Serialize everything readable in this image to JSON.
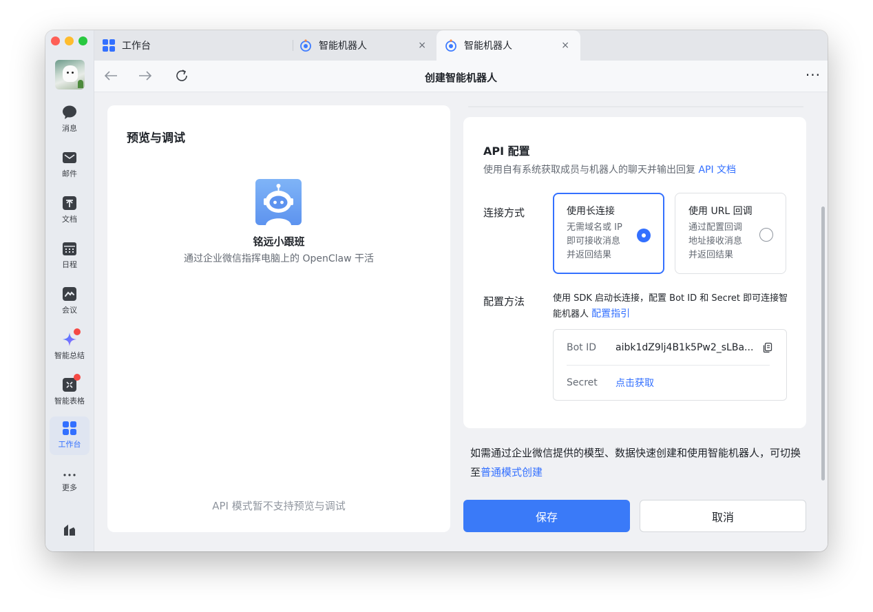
{
  "window": {
    "traffic_colors": [
      "#fe5f57",
      "#febc2e",
      "#28c840"
    ]
  },
  "rail": {
    "items": [
      {
        "label": "消息",
        "icon": "chat-bubble-icon"
      },
      {
        "label": "邮件",
        "icon": "mail-icon"
      },
      {
        "label": "文档",
        "icon": "document-icon"
      },
      {
        "label": "日程",
        "icon": "calendar-icon"
      },
      {
        "label": "会议",
        "icon": "meeting-icon"
      },
      {
        "label": "智能总结",
        "icon": "sparkle-icon",
        "badge": true
      },
      {
        "label": "智能表格",
        "icon": "smart-sheet-icon",
        "badge": true
      },
      {
        "label": "工作台",
        "icon": "workbench-icon",
        "active": true
      },
      {
        "label": "更多",
        "icon": "more-dots-icon"
      }
    ],
    "bottom_icon": "brand-icon"
  },
  "tabs": [
    {
      "label": "工作台",
      "icon": "workbench-icon",
      "closable": false
    },
    {
      "label": "智能机器人",
      "icon": "robot-icon",
      "closable": true,
      "close": "×"
    },
    {
      "label": "智能机器人",
      "icon": "robot-icon",
      "closable": true,
      "close": "×",
      "active": true
    }
  ],
  "toolbar": {
    "title": "创建智能机器人",
    "more": "···"
  },
  "preview": {
    "heading": "预览与调试",
    "bot_name": "铭远小跟班",
    "bot_desc": "通过企业微信指挥电脑上的 OpenClaw 干活",
    "note": "API 模式暂不支持预览与调试"
  },
  "api": {
    "title": "API 配置",
    "subtitle": "使用自有系统获取成员与机器人的聊天并输出回复",
    "subtitle_link": "API 文档",
    "connect_label": "连接方式",
    "options": [
      {
        "title": "使用长连接",
        "lines": [
          "无需域名或 IP",
          "即可接收消息",
          "并返回结果"
        ],
        "selected": true
      },
      {
        "title": "使用 URL 回调",
        "lines": [
          "通过配置回调",
          "地址接收消息",
          "并返回结果"
        ],
        "selected": false
      }
    ],
    "method_label": "配置方法",
    "method_text": "使用 SDK 启动长连接，配置 Bot ID 和 Secret 即可连接智能机器人",
    "method_link": "配置指引",
    "bot_id_label": "Bot ID",
    "bot_id_value": "aibk1dZ9lj4B1k5Pw2_sLBa...",
    "secret_label": "Secret",
    "secret_value": "点击获取"
  },
  "hint": {
    "text": "如需通过企业微信提供的模型、数据快速创建和使用智能机器人，可切换至",
    "link": "普通模式创建"
  },
  "buttons": {
    "save": "保存",
    "cancel": "取消"
  },
  "colors": {
    "accent": "#3370ff",
    "primary_button": "#3a7af8",
    "badge": "#f54a45"
  }
}
